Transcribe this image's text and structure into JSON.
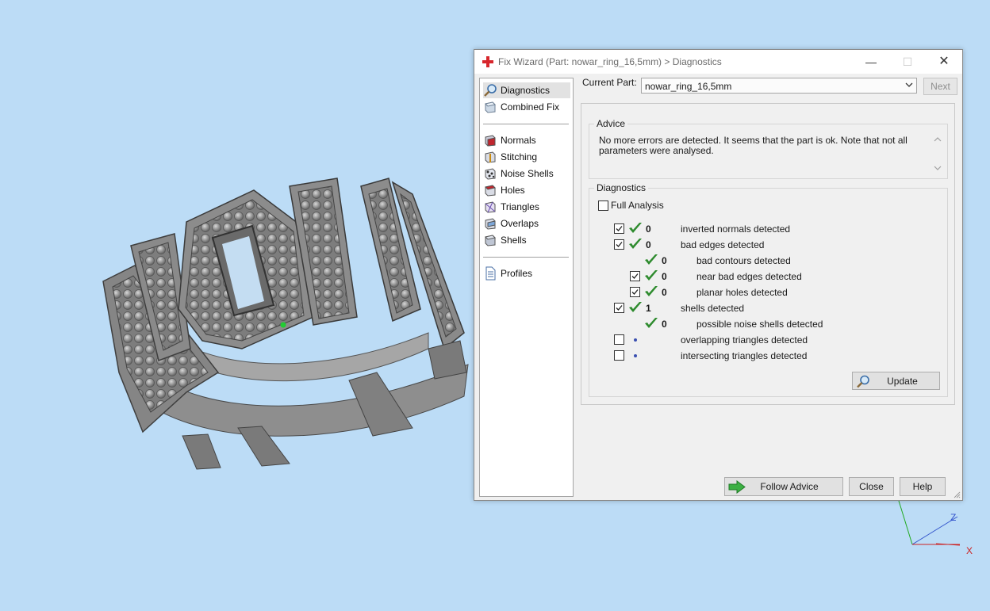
{
  "window": {
    "title": "Fix Wizard (Part: nowar_ring_16,5mm) > Diagnostics",
    "minimize": "—",
    "maximize": "☐",
    "close": "✕"
  },
  "nav": {
    "items_top": [
      {
        "label": "Diagnostics",
        "icon": "magnifier-icon",
        "selected": true
      },
      {
        "label": "Combined Fix",
        "icon": "cube-icon"
      }
    ],
    "items_fix": [
      {
        "label": "Normals",
        "icon": "normals-cube-icon"
      },
      {
        "label": "Stitching",
        "icon": "stitching-cube-icon"
      },
      {
        "label": "Noise Shells",
        "icon": "noise-shells-icon"
      },
      {
        "label": "Holes",
        "icon": "holes-cube-icon"
      },
      {
        "label": "Triangles",
        "icon": "triangles-icon"
      },
      {
        "label": "Overlaps",
        "icon": "overlaps-cube-icon"
      },
      {
        "label": "Shells",
        "icon": "shells-cube-icon"
      }
    ],
    "items_bottom": [
      {
        "label": "Profiles",
        "icon": "document-icon"
      }
    ]
  },
  "current_part": {
    "label": "Current Part:",
    "value": "nowar_ring_16,5mm"
  },
  "next_button": "Next",
  "advice": {
    "title": "Advice",
    "text": "No more errors are detected. It seems that the part is ok. Note that not all parameters were analysed."
  },
  "diagnostics": {
    "title": "Diagnostics",
    "full_analysis": {
      "label": "Full Analysis",
      "checked": false
    },
    "rows": [
      {
        "checkbox": true,
        "checked": true,
        "status": "ok",
        "count": "0",
        "label": "inverted normals detected",
        "indent": 0
      },
      {
        "checkbox": true,
        "checked": true,
        "status": "ok",
        "count": "0",
        "label": "bad edges detected",
        "indent": 0
      },
      {
        "checkbox": false,
        "checked": false,
        "status": "ok",
        "count": "0",
        "label": "bad contours detected",
        "indent": 1
      },
      {
        "checkbox": true,
        "checked": true,
        "status": "ok",
        "count": "0",
        "label": "near bad edges detected",
        "indent": 1
      },
      {
        "checkbox": true,
        "checked": true,
        "status": "ok",
        "count": "0",
        "label": "planar holes detected",
        "indent": 1
      },
      {
        "checkbox": true,
        "checked": true,
        "status": "ok",
        "count": "1",
        "label": "shells detected",
        "indent": 0
      },
      {
        "checkbox": false,
        "checked": false,
        "status": "ok",
        "count": "0",
        "label": "possible noise shells detected",
        "indent": 1
      },
      {
        "checkbox": true,
        "checked": false,
        "status": "pending",
        "count": "",
        "label": "overlapping triangles detected",
        "indent": 0
      },
      {
        "checkbox": true,
        "checked": false,
        "status": "pending",
        "count": "",
        "label": "intersecting triangles detected",
        "indent": 0
      }
    ],
    "update_button": "Update"
  },
  "buttons": {
    "follow_advice": "Follow Advice",
    "close": "Close",
    "help": "Help"
  },
  "axis_labels": {
    "z": "Z",
    "x": "X"
  },
  "colors": {
    "background": "#bcdcf6",
    "check_green": "#2e8b2e",
    "pending_dot": "#3a4fb0",
    "ring_gray": "#8a8a8a"
  }
}
